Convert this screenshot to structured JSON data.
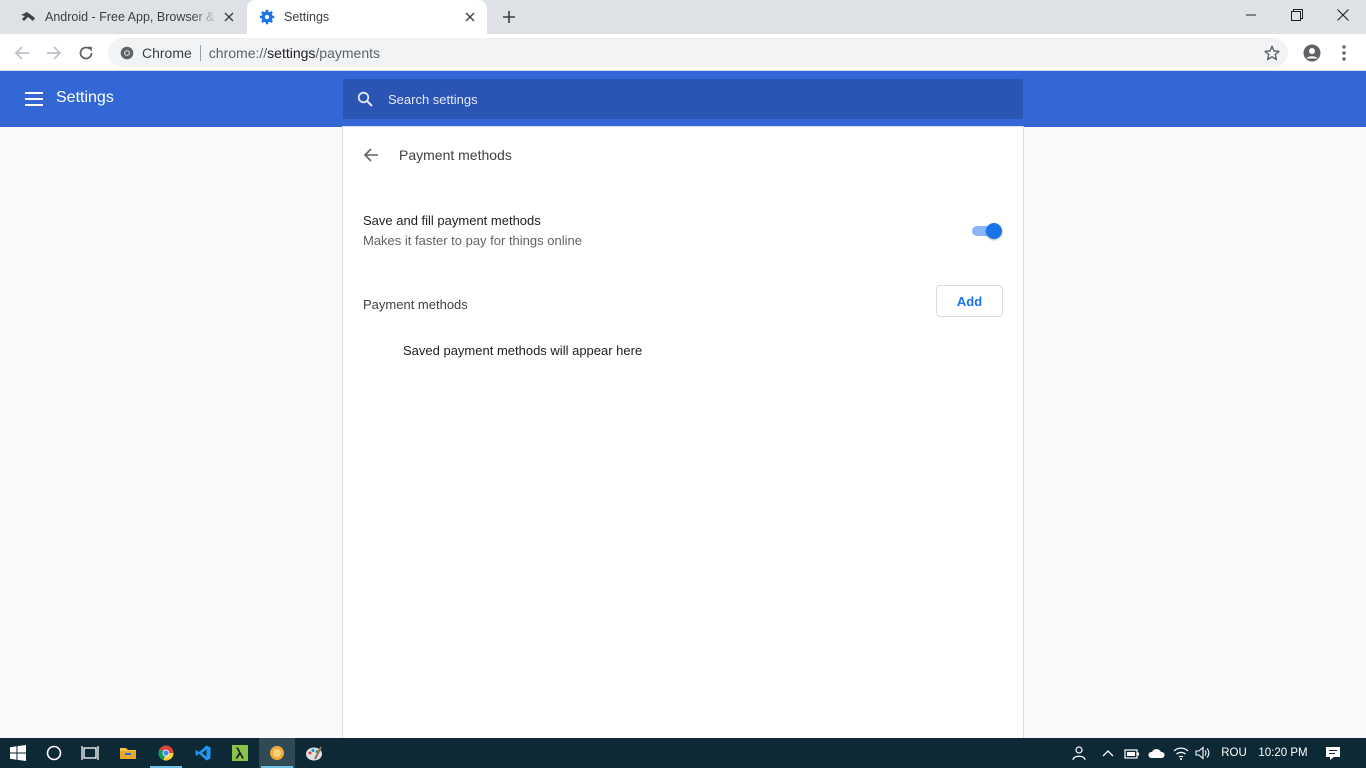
{
  "browser": {
    "tabs": [
      {
        "title": "Android - Free App, Browser & Games",
        "active": false
      },
      {
        "title": "Settings",
        "active": true
      }
    ],
    "omnibox": {
      "site_name": "Chrome",
      "url_scheme": "chrome://",
      "url_host": "settings",
      "url_path": "/payments"
    }
  },
  "settings": {
    "header_title": "Settings",
    "search_placeholder": "Search settings",
    "page_title": "Payment methods",
    "toggle_row": {
      "title": "Save and fill payment methods",
      "subtitle": "Makes it faster to pay for things online",
      "enabled": true
    },
    "section_title": "Payment methods",
    "add_button": "Add",
    "empty_message": "Saved payment methods will appear here"
  },
  "taskbar": {
    "language": "ROU",
    "time": "10:20 PM"
  },
  "colors": {
    "header_blue": "#3367d6",
    "search_bg": "#2a55b4",
    "accent": "#1a73e8",
    "taskbar": "#0d2935"
  }
}
